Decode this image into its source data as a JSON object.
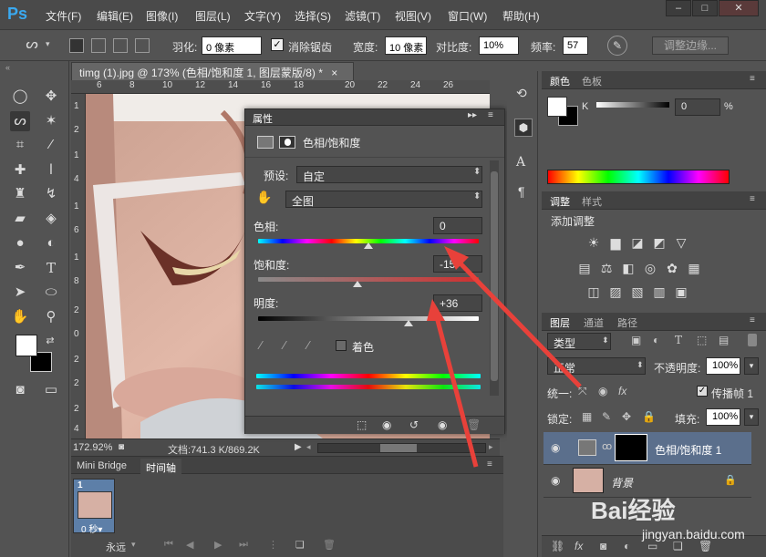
{
  "menubar": {
    "logo": "Ps",
    "items": [
      "文件(F)",
      "编辑(E)",
      "图像(I)",
      "图层(L)",
      "文字(Y)",
      "选择(S)",
      "滤镜(T)",
      "视图(V)",
      "窗口(W)",
      "帮助(H)"
    ],
    "window_controls": [
      "–",
      "□",
      "✕"
    ]
  },
  "options": {
    "feather_label": "羽化:",
    "feather_value": "0 像素",
    "antialias_label": "消除锯齿",
    "width_label": "宽度:",
    "width_value": "10 像素",
    "contrast_label": "对比度:",
    "contrast_value": "10%",
    "frequency_label": "频率:",
    "frequency_value": "57",
    "refine_edge_label": "调整边缘..."
  },
  "document": {
    "tab_title": "timg (1).jpg @ 173% (色相/饱和度 1, 图层蒙版/8) *",
    "tab_close": "×",
    "ruler_h": [
      "6",
      "8",
      "10",
      "12",
      "14",
      "16",
      "18",
      "20",
      "22",
      "24",
      "26"
    ],
    "ruler_v": [
      "1",
      "2",
      "1",
      "4",
      "1",
      "6",
      "1",
      "8",
      "2",
      "0",
      "2",
      "2",
      "2",
      "4"
    ],
    "zoom": "172.92%",
    "doc_info": "文档:741.3 K/869.2K"
  },
  "properties": {
    "panel_title": "属性",
    "adjustment_name": "色相/饱和度",
    "preset_label": "预设:",
    "preset_value": "自定",
    "channel_value": "全图",
    "hue_label": "色相:",
    "hue_value": "0",
    "hue_level": 0.5,
    "saturation_label": "饱和度:",
    "saturation_value": "-15",
    "saturation_level": 0.45,
    "lightness_label": "明度:",
    "lightness_value": "+36",
    "lightness_level": 0.68,
    "colorize_label": "着色"
  },
  "timeline": {
    "tabs": [
      "Mini Bridge",
      "时间轴"
    ],
    "frame_number": "1",
    "frame_delay": "0 秒▾",
    "loop": "永远"
  },
  "color_panel": {
    "tabs": [
      "颜色",
      "色板"
    ],
    "k_label": "K",
    "k_value": "0",
    "k_unit": "%"
  },
  "adjustments_panel": {
    "tabs": [
      "调整",
      "样式"
    ],
    "title": "添加调整"
  },
  "layers_panel": {
    "tabs": [
      "图层",
      "通道",
      "路径"
    ],
    "filter_kind": "类型",
    "blend_mode": "正常",
    "opacity_label": "不透明度:",
    "opacity_value": "100%",
    "unify_label": "统一:",
    "propagate_label": "传播帧 1",
    "lock_label": "锁定:",
    "fill_label": "填充:",
    "fill_value": "100%",
    "layers": [
      {
        "name": "色相/饱和度 1"
      },
      {
        "name": "背景"
      }
    ]
  },
  "watermark": {
    "brand_text": "Bai经验",
    "url": "jingyan.baidu.com"
  },
  "colors": {
    "annotation_arrow": "#e8413a",
    "selected_layer": "#5b6f8c"
  }
}
